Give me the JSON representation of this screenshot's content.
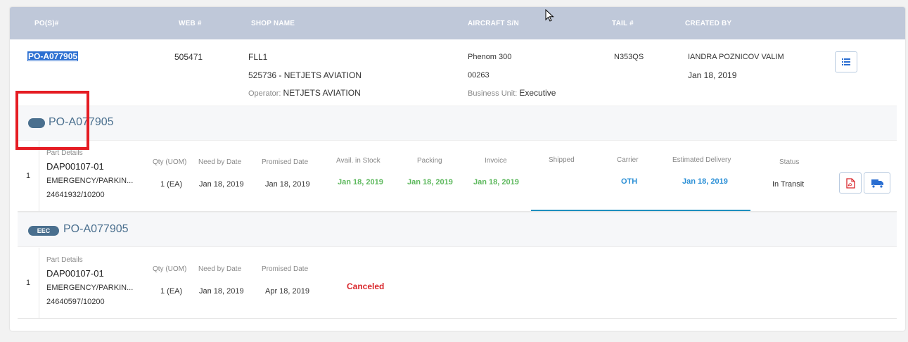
{
  "header": {
    "cols": [
      "PO(S)#",
      "WEB #",
      "SHOP NAME",
      "AIRCRAFT S/N",
      "TAIL #",
      "CREATED BY"
    ]
  },
  "summary": {
    "po": "PO-A077905",
    "web": "505471",
    "shop_code": "FLL1",
    "shop_name": "525736 - NETJETS AVIATION",
    "operator_label": "Operator:",
    "operator_value": "NETJETS AVIATION",
    "aircraft_model": "Phenom 300",
    "aircraft_sn": "00263",
    "bu_label": "Business Unit:",
    "bu_value": "Executive",
    "tail": "N353QS",
    "created_by": "IANDRA POZNICOV VALIM",
    "created_date": "Jan 18, 2019"
  },
  "sections": [
    {
      "badge": "",
      "title": "PO-A077905",
      "row": {
        "num": "1",
        "part_label": "Part Details",
        "part_number": "DAP00107-01",
        "part_desc": "EMERGENCY/PARKIN...",
        "part_ref": "24641932/10200",
        "qty_label": "Qty (UOM)",
        "qty": "1 (EA)",
        "need_label": "Need by Date",
        "need": "Jan 18, 2019",
        "promised_label": "Promised Date",
        "promised": "Jan 18, 2019",
        "stock_label": "Avail. in Stock",
        "stock": "Jan 18, 2019",
        "packing_label": "Packing",
        "packing": "Jan 18, 2019",
        "invoice_label": "Invoice",
        "invoice": "Jan 18, 2019",
        "shipped_label": "Shipped",
        "carrier_label": "Carrier",
        "carrier": "OTH",
        "est_label": "Estimated Delivery",
        "est": "Jan 18, 2019",
        "status_label": "Status",
        "status": "In Transit"
      }
    },
    {
      "badge": "EEC",
      "title": "PO-A077905",
      "row": {
        "num": "1",
        "part_label": "Part Details",
        "part_number": "DAP00107-01",
        "part_desc": "EMERGENCY/PARKIN...",
        "part_ref": "24640597/10200",
        "qty_label": "Qty (UOM)",
        "qty": "1 (EA)",
        "need_label": "Need by Date",
        "need": "Jan 18, 2019",
        "promised_label": "Promised Date",
        "promised": "Apr 18, 2019",
        "status": "Canceled"
      }
    }
  ],
  "colors": {
    "accent": "#4a6f8e",
    "header_bg": "#bfc8d9",
    "green": "#5cb85c",
    "blue": "#2a8fd6",
    "red": "#d9262b",
    "highlight": "#e51c23"
  },
  "icons": {
    "list": "list-icon",
    "pdf": "pdf-icon",
    "truck": "truck-icon",
    "cursor": "mouse-cursor-icon"
  }
}
